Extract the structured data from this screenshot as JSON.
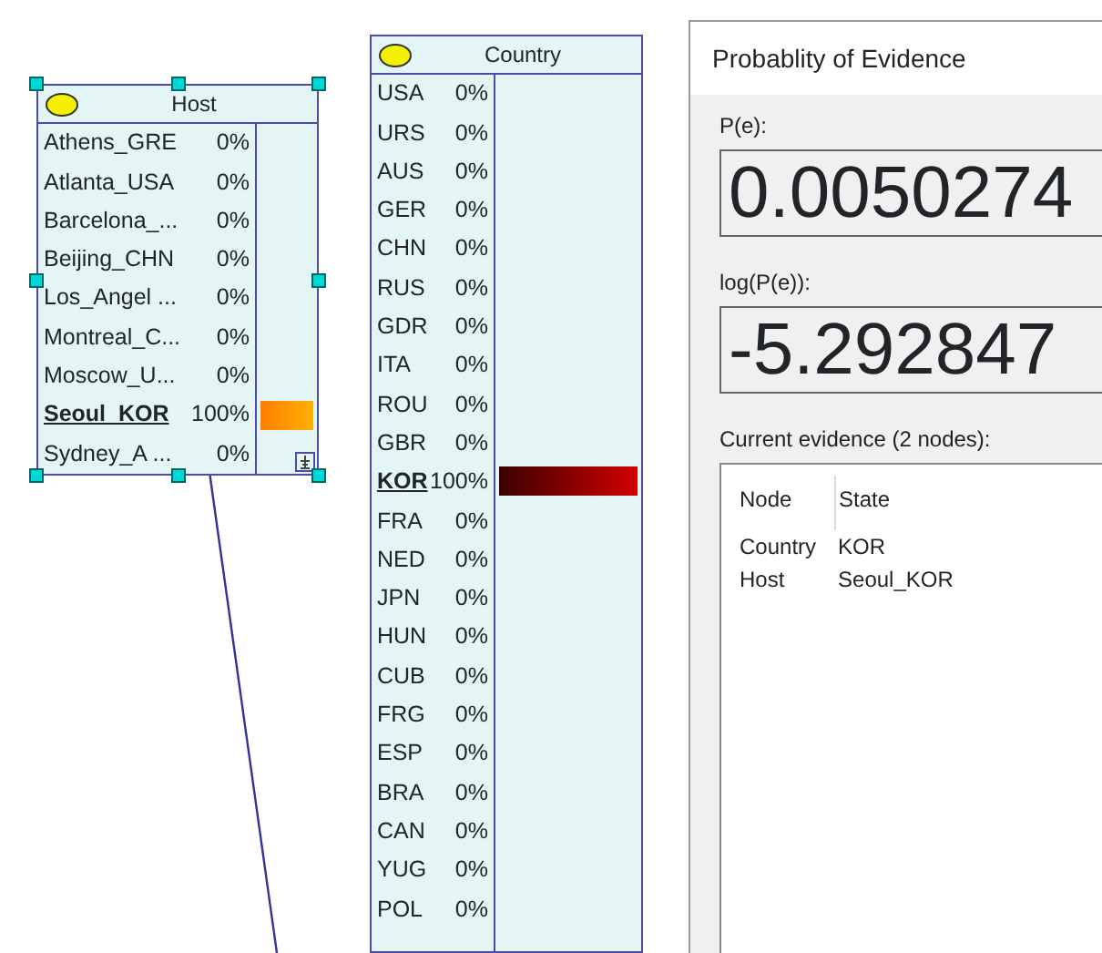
{
  "nodes": [
    {
      "title": "Host",
      "selected": true,
      "color": "#ffb000",
      "has_scroll_icon": true,
      "states": [
        {
          "name": "Athens_GRE",
          "value": "0%",
          "evidence": false
        },
        {
          "name": "Atlanta_USA",
          "value": "0%",
          "evidence": false
        },
        {
          "name": "Barcelona_...",
          "value": "0%",
          "evidence": false
        },
        {
          "name": "Beijing_CHN",
          "value": "0%",
          "evidence": false
        },
        {
          "name": "Los_Angel ...",
          "value": "0%",
          "evidence": false
        },
        {
          "name": "Montreal_C...",
          "value": "0%",
          "evidence": false
        },
        {
          "name": "Moscow_U...",
          "value": "0%",
          "evidence": false
        },
        {
          "name": "Seoul_KOR",
          "value": "100%",
          "evidence": true
        },
        {
          "name": "Sydney_A ...",
          "value": "0%",
          "evidence": false
        }
      ]
    },
    {
      "title": "Country",
      "selected": false,
      "color": "#d00000",
      "has_scroll_icon": false,
      "states": [
        {
          "name": "USA",
          "value": "0%",
          "evidence": false
        },
        {
          "name": "URS",
          "value": "0%",
          "evidence": false
        },
        {
          "name": "AUS",
          "value": "0%",
          "evidence": false
        },
        {
          "name": "GER",
          "value": "0%",
          "evidence": false
        },
        {
          "name": "CHN",
          "value": "0%",
          "evidence": false
        },
        {
          "name": "RUS",
          "value": "0%",
          "evidence": false
        },
        {
          "name": "GDR",
          "value": "0%",
          "evidence": false
        },
        {
          "name": "ITA",
          "value": "0%",
          "evidence": false
        },
        {
          "name": "ROU",
          "value": "0%",
          "evidence": false
        },
        {
          "name": "GBR",
          "value": "0%",
          "evidence": false
        },
        {
          "name": "KOR",
          "value": "100%",
          "evidence": true
        },
        {
          "name": "FRA",
          "value": "0%",
          "evidence": false
        },
        {
          "name": "NED",
          "value": "0%",
          "evidence": false
        },
        {
          "name": "JPN",
          "value": "0%",
          "evidence": false
        },
        {
          "name": "HUN",
          "value": "0%",
          "evidence": false
        },
        {
          "name": "CUB",
          "value": "0%",
          "evidence": false
        },
        {
          "name": "FRG",
          "value": "0%",
          "evidence": false
        },
        {
          "name": "ESP",
          "value": "0%",
          "evidence": false
        },
        {
          "name": "BRA",
          "value": "0%",
          "evidence": false
        },
        {
          "name": "CAN",
          "value": "0%",
          "evidence": false
        },
        {
          "name": "YUG",
          "value": "0%",
          "evidence": false
        },
        {
          "name": "POL",
          "value": "0%",
          "evidence": false
        }
      ]
    }
  ],
  "dialog": {
    "title": "Probablity of Evidence",
    "fields": [
      {
        "label": "P(e):",
        "value": "0.0050274"
      },
      {
        "label": "log(P(e)):",
        "value": "-5.292847"
      }
    ],
    "evidence_label": "Current evidence (2 nodes):",
    "columns": [
      "Node",
      "State"
    ],
    "rows": [
      [
        "Country",
        "KOR"
      ],
      [
        "Host",
        "Seoul_KOR"
      ]
    ]
  }
}
